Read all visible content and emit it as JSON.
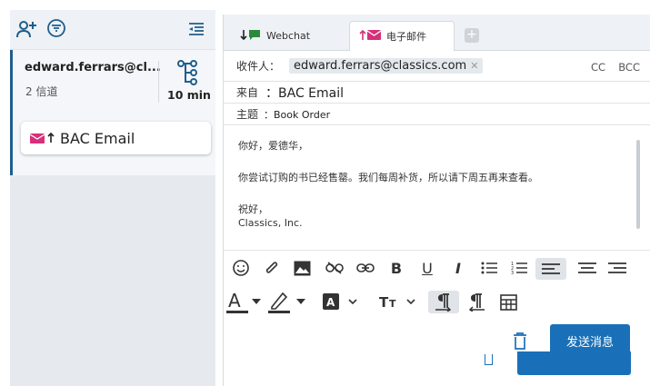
{
  "sidebar": {
    "conversation": {
      "email": "edward.ferrars@cl...",
      "channels": "2 信道",
      "time": "10 min"
    },
    "channel_card": {
      "label": "BAC Email"
    }
  },
  "tabs": [
    {
      "label": "Webchat",
      "active": false
    },
    {
      "label": "电子邮件",
      "active": true
    }
  ],
  "compose": {
    "to_label": "收件人：",
    "to_chip": "edward.ferrars@classics.com",
    "cc_label": "CC",
    "bcc_label": "BCC",
    "from_label": "来自",
    "from_value": "：BAC Email",
    "subject_label": "主题",
    "subject_value": "：Book Order",
    "body": {
      "greeting": "你好，爱德华，",
      "line1": "你尝试订购的书已经售罄。我们每周补货，所以请下周五再来查看。",
      "closing": "祝好，",
      "signature": "Classics, Inc."
    },
    "send_label": "发送消息"
  },
  "colors": {
    "accent": "#1a70b8",
    "brand_magenta": "#d6307a",
    "webchat_green": "#2a8a3a",
    "active_border": "#1f5e8c"
  }
}
